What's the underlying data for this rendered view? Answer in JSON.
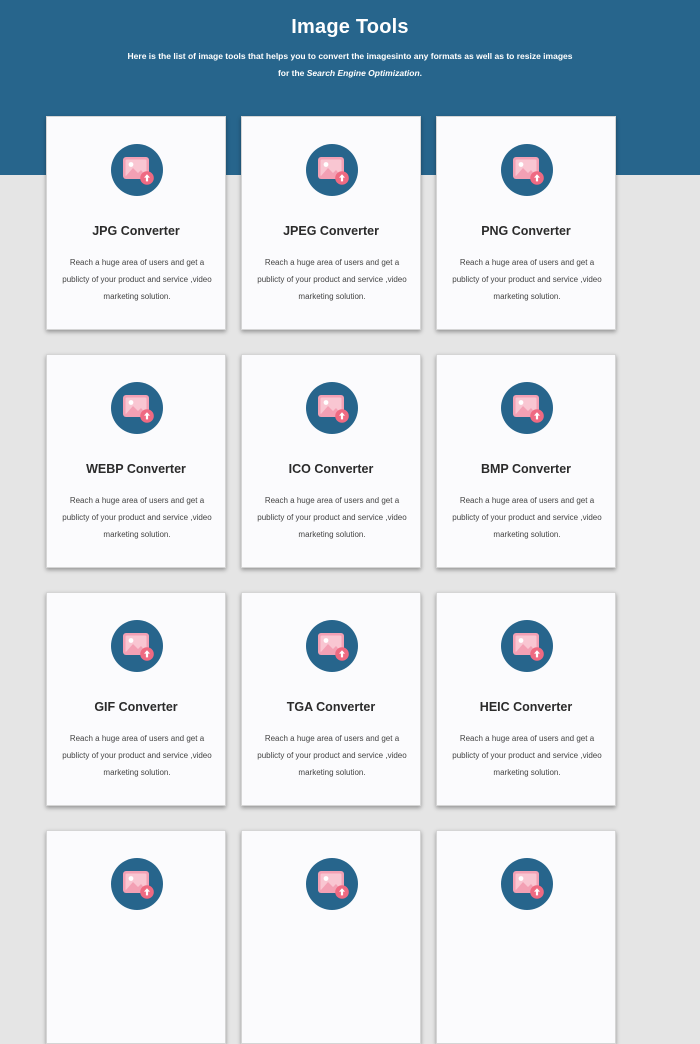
{
  "header": {
    "title": "Image Tools",
    "subtitle_line1": "Here is the list of image tools that helps you to convert the imagesinto any formats as well as to resize images",
    "subtitle_prefix": "for the ",
    "subtitle_emphasis": "Search Engine Optimization",
    "subtitle_suffix": "."
  },
  "colors": {
    "header_bg": "#27658c",
    "page_bg": "#e5e5e5",
    "card_bg": "#fbfbfd",
    "icon_circle": "#27658c",
    "icon_image": "#f3a0b4",
    "icon_badge": "#ef6a82"
  },
  "cards": [
    {
      "title": "JPG Converter",
      "desc": "Reach a huge area of users and get a publicty of your product and service ,video marketing solution.",
      "icon": "image-upload-icon"
    },
    {
      "title": "JPEG Converter",
      "desc": "Reach a huge area of users and get a publicty of your product and service ,video marketing solution.",
      "icon": "image-upload-icon"
    },
    {
      "title": "PNG Converter",
      "desc": "Reach a huge area of users and get a publicty of your product and service ,video marketing solution.",
      "icon": "image-upload-icon"
    },
    {
      "title": "WEBP Converter",
      "desc": "Reach a huge area of users and get a publicty of your product and service ,video marketing solution.",
      "icon": "image-upload-icon"
    },
    {
      "title": "ICO Converter",
      "desc": "Reach a huge area of users and get a publicty of your product and service ,video marketing solution.",
      "icon": "image-upload-icon"
    },
    {
      "title": "BMP Converter",
      "desc": "Reach a huge area of users and get a publicty of your product and service ,video marketing solution.",
      "icon": "image-upload-icon"
    },
    {
      "title": "GIF Converter",
      "desc": "Reach a huge area of users and get a publicty of your product and service ,video marketing solution.",
      "icon": "image-upload-icon"
    },
    {
      "title": "TGA Converter",
      "desc": "Reach a huge area of users and get a publicty of your product and service ,video marketing solution.",
      "icon": "image-upload-icon"
    },
    {
      "title": "HEIC Converter",
      "desc": "Reach a huge area of users and get a publicty of your product and service ,video marketing solution.",
      "icon": "image-upload-icon"
    },
    {
      "title": "",
      "desc": "",
      "icon": "image-upload-icon"
    },
    {
      "title": "",
      "desc": "",
      "icon": "image-upload-icon"
    },
    {
      "title": "",
      "desc": "",
      "icon": "image-upload-icon"
    }
  ]
}
